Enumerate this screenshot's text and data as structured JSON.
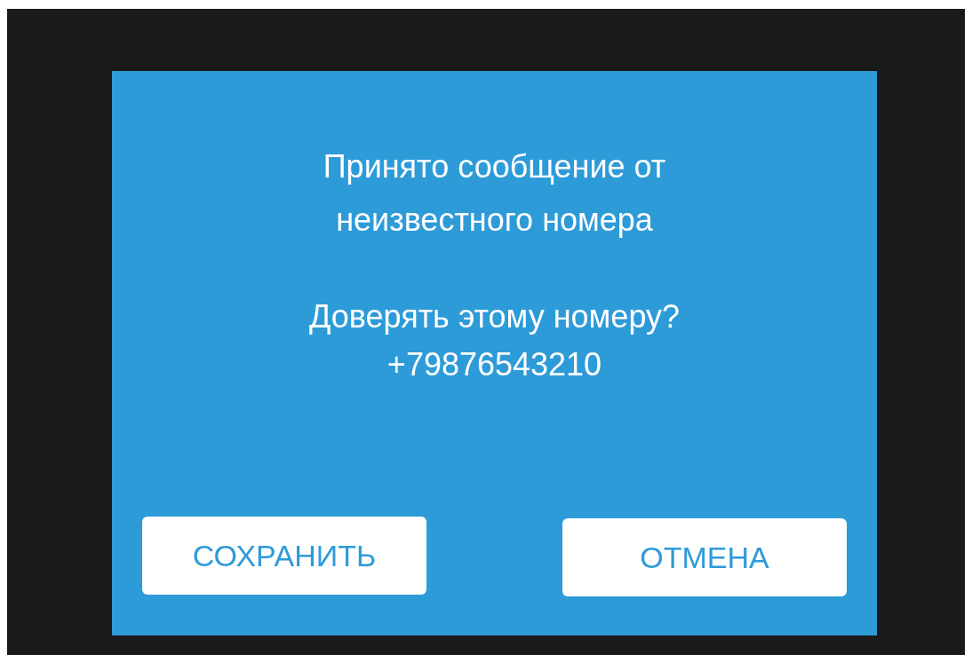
{
  "dialog": {
    "message": "Принято сообщение от неизвестного номера",
    "question": "Доверять этому номеру?",
    "phone": "+79876543210",
    "buttons": [
      {
        "label": "СОХРАНИТЬ"
      },
      {
        "label": "ОТМЕНА"
      }
    ]
  }
}
